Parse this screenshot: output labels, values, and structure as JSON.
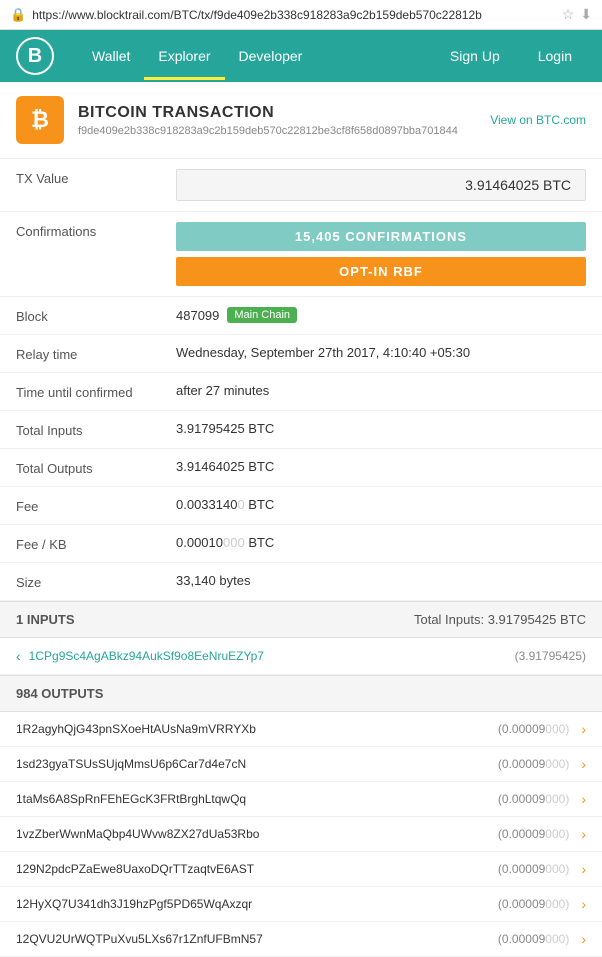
{
  "urlbar": {
    "url": "https://www.blocktrail.com/BTC/tx/f9de409e2b338c918283a9c2b159deb570c22812b",
    "lock_symbol": "🔒"
  },
  "nav": {
    "logo": "B",
    "links": [
      {
        "label": "Wallet",
        "active": false
      },
      {
        "label": "Explorer",
        "active": true
      },
      {
        "label": "Developer",
        "active": false
      }
    ],
    "right": [
      {
        "label": "Sign Up"
      },
      {
        "label": "Login"
      }
    ]
  },
  "tx": {
    "title": "BITCOIN TRANSACTION",
    "view_label": "View on BTC.com",
    "hash": "f9de409e2b338c918283a9c2b159deb570c22812be3cf8f658d0897bba701844",
    "btc_symbol": "₿"
  },
  "details": {
    "rows": [
      {
        "label": "TX Value",
        "type": "box",
        "value": "3.91464025 BTC"
      },
      {
        "label": "Confirmations",
        "type": "confirmations",
        "conf": "15,405 CONFIRMATIONS",
        "rbf": "OPT-IN RBF"
      },
      {
        "label": "Block",
        "type": "block",
        "number": "487099",
        "badge": "Main Chain"
      },
      {
        "label": "Relay time",
        "type": "text",
        "value": "Wednesday, September 27th 2017, 4:10:40 +05:30"
      },
      {
        "label": "Time until confirmed",
        "type": "text",
        "value": "after 27 minutes"
      },
      {
        "label": "Total Inputs",
        "type": "text",
        "value": "3.91795425 BTC"
      },
      {
        "label": "Total Outputs",
        "type": "text",
        "value": "3.91464025 BTC"
      },
      {
        "label": "Fee",
        "type": "fee",
        "value": "0.0033140",
        "muted": "0",
        "suffix": " BTC"
      },
      {
        "label": "Fee / KB",
        "type": "fee",
        "value": "0.00010",
        "muted": "000",
        "suffix": " BTC"
      },
      {
        "label": "Size",
        "type": "text",
        "value": "33,140 bytes"
      }
    ]
  },
  "inputs_section": {
    "header": "1 INPUTS",
    "total_label": "Total Inputs: 3.91795425 BTC",
    "items": [
      {
        "address": "1CPg9Sc4AgABkz94AukSf9o8EeNruEZYp7",
        "amount": "(3.91795425)"
      }
    ]
  },
  "outputs_section": {
    "header": "984 OUTPUTS",
    "items": [
      {
        "address": "1R2agyhQjG43pnSXoeHtAUsNa9mVRRYXb",
        "amount": "(0.00009",
        "muted": "000)"
      },
      {
        "address": "1sd23gyaTSUsSUjqMmsU6p6Car7d4e7cN",
        "amount": "(0.00009",
        "muted": "000)"
      },
      {
        "address": "1taMs6A8SpRnFEhEGcK3FRtBrghLtqwQq",
        "amount": "(0.00009",
        "muted": "000)"
      },
      {
        "address": "1vzZberWwnMaQbp4UWvw8ZX27dUa53Rbo",
        "amount": "(0.00009",
        "muted": "000)"
      },
      {
        "address": "129N2pdcPZaEwe8UaxoDQrTTzaqtvE6AST",
        "amount": "(0.00009",
        "muted": "000)"
      },
      {
        "address": "12HyXQ7U341dh3J19hzPgf5PD65WqAxzqr",
        "amount": "(0.00009",
        "muted": "000)"
      },
      {
        "address": "12QVU2UrWQTPuXvu5LXs67r1ZnfUFBmN57",
        "amount": "(0.00009",
        "muted": "000)"
      }
    ]
  }
}
